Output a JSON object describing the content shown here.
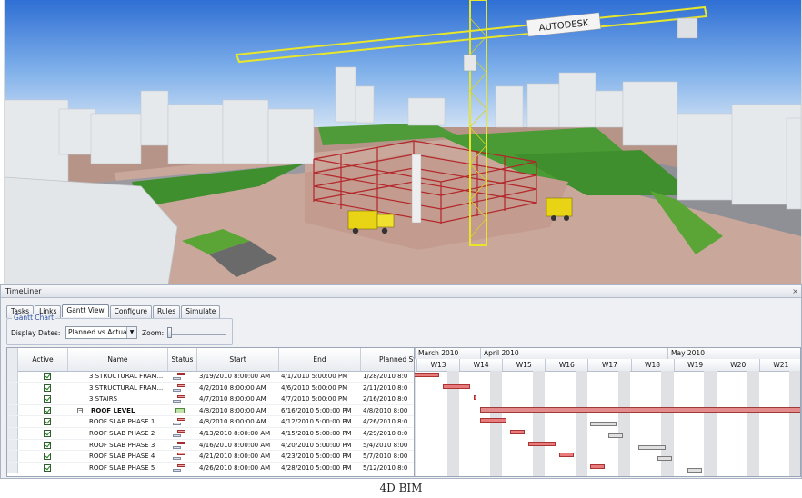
{
  "scene": {
    "crane_brand": "AUTODESK",
    "sky_color": "#a6c8ef",
    "ground_color": "#c9a79b",
    "grass_color": "#3f8f2e",
    "steel_color": "#b3262a",
    "crane_color": "#e8e62a"
  },
  "panel": {
    "title": "TimeLiner",
    "close": "×",
    "tabs": [
      {
        "label": "Tasks"
      },
      {
        "label": "Links"
      },
      {
        "label": "Gantt View"
      },
      {
        "label": "Configure"
      },
      {
        "label": "Rules"
      },
      {
        "label": "Simulate"
      }
    ],
    "active_tab": "Gantt View",
    "gantt": {
      "legend": "Gantt Chart",
      "display_label": "Display Dates:",
      "display_value": "Planned vs Actual",
      "zoom_label": "Zoom:"
    },
    "columns": {
      "active": "Active",
      "name": "Name",
      "status": "Status",
      "start": "Start",
      "end": "End",
      "planned": "Planned St"
    },
    "rows": [
      {
        "active": true,
        "name": "3 STRUCTURAL FRAM...",
        "start": "3/19/2010 8:00:00 AM",
        "end": "4/1/2010 5:00:00 PM",
        "planned": "1/28/2010 8:0",
        "group": false
      },
      {
        "active": true,
        "name": "3 STRUCTURAL FRAM...",
        "start": "4/2/2010 8:00:00 AM",
        "end": "4/6/2010 5:00:00 PM",
        "planned": "2/11/2010 8:0",
        "group": false
      },
      {
        "active": true,
        "name": "3 STAIRS",
        "start": "4/7/2010 8:00:00 AM",
        "end": "4/7/2010 5:00:00 PM",
        "planned": "2/16/2010 8:0",
        "group": false
      },
      {
        "active": true,
        "name": "ROOF LEVEL",
        "start": "4/8/2010 8:00:00 AM",
        "end": "6/16/2010 5:00:00 PM",
        "planned": "4/8/2010 8:00",
        "group": true,
        "expander": "−"
      },
      {
        "active": true,
        "name": "ROOF SLAB PHASE 1",
        "start": "4/8/2010 8:00:00 AM",
        "end": "4/12/2010 5:00:00 PM",
        "planned": "4/26/2010 8:0",
        "group": false
      },
      {
        "active": true,
        "name": "ROOF SLAB PHASE 2",
        "start": "4/13/2010 8:00:00 AM",
        "end": "4/15/2010 5:00:00 PM",
        "planned": "4/29/2010 8:0",
        "group": false
      },
      {
        "active": true,
        "name": "ROOF SLAB PHASE 3",
        "start": "4/16/2010 8:00:00 AM",
        "end": "4/20/2010 5:00:00 PM",
        "planned": "5/4/2010 8:00",
        "group": false
      },
      {
        "active": true,
        "name": "ROOF SLAB PHASE 4",
        "start": "4/21/2010 8:00:00 AM",
        "end": "4/23/2010 5:00:00 PM",
        "planned": "5/7/2010 8:00",
        "group": false
      },
      {
        "active": true,
        "name": "ROOF SLAB PHASE 5",
        "start": "4/26/2010 8:00:00 AM",
        "end": "4/28/2010 5:00:00 PM",
        "planned": "5/12/2010 8:0",
        "group": false
      }
    ],
    "timeline": {
      "months": [
        "March 2010",
        "April 2010",
        "May 2010"
      ],
      "weeks": [
        "W13",
        "W14",
        "W15",
        "W16",
        "W17",
        "W18",
        "W19",
        "W20",
        "W21"
      ],
      "actual_color": "#e87c7c",
      "planned_color": "#e0e0e0"
    }
  },
  "caption": "4D BIM"
}
